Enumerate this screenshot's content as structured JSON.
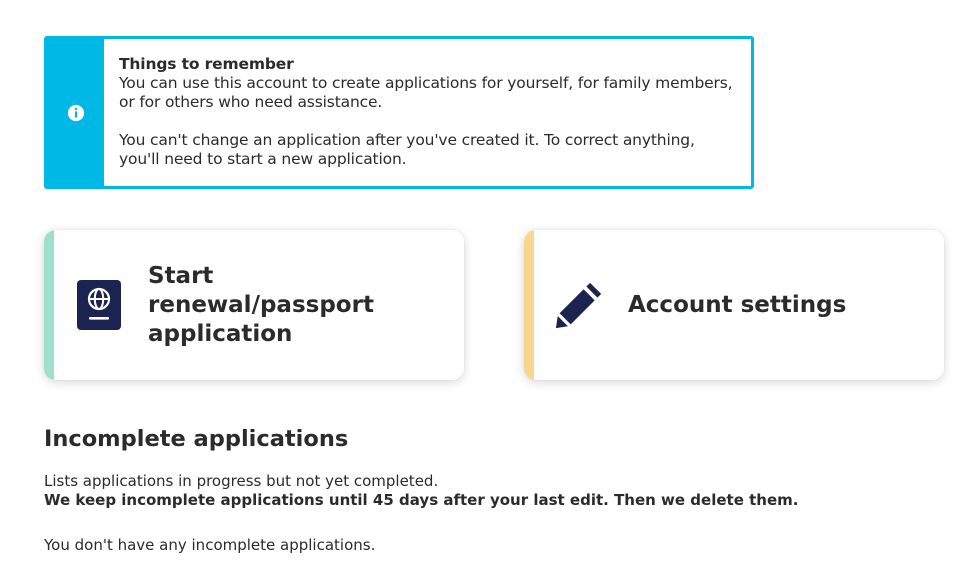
{
  "notice": {
    "title": "Things to remember",
    "paragraph_1": "You can use this account to create applications for yourself, for family members, or for others who need assistance.",
    "paragraph_2": "You can't change an application after you've created it. To correct anything, you'll need to start a new application.",
    "icon": "info-icon",
    "accent_color": "#00b8e6"
  },
  "cards": {
    "renewal": {
      "label": "Start renewal/passport application",
      "icon": "passport-icon",
      "accent_color": "#9fdfcb",
      "icon_color": "#1b2450"
    },
    "account": {
      "label": "Account settings",
      "icon": "pencil-icon",
      "accent_color": "#f9d690",
      "icon_color": "#1b2450"
    }
  },
  "incomplete": {
    "heading": "Incomplete applications",
    "description": "Lists applications in progress but not yet completed.",
    "retention_notice": "We keep incomplete applications until 45 days after your last edit. Then we delete them.",
    "empty_message": "You don't have any incomplete applications."
  }
}
